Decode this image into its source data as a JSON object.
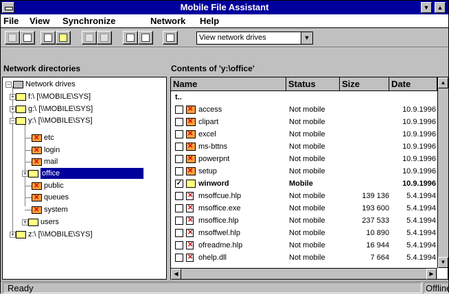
{
  "window": {
    "title": "Mobile File Assistant"
  },
  "menu": [
    {
      "label": "File"
    },
    {
      "label": "View"
    },
    {
      "label": "Synchronize"
    },
    {
      "label": "Network"
    },
    {
      "label": "Help"
    }
  ],
  "toolbar": {
    "view_select": "View network drives"
  },
  "tree_panel": {
    "header": "Network directories"
  },
  "contents_panel": {
    "header": "Contents of 'y:\\office'"
  },
  "tree": [
    {
      "label": "Network drives"
    },
    {
      "label": "f:\\  [\\\\MOBILE\\SYS]"
    },
    {
      "label": "g:\\  [\\\\MOBILE\\SYS]"
    },
    {
      "label": "y:\\  [\\\\MOBILE\\SYS]"
    },
    {
      "label": "etc"
    },
    {
      "label": "login"
    },
    {
      "label": "mail"
    },
    {
      "label": "office"
    },
    {
      "label": "public"
    },
    {
      "label": "queues"
    },
    {
      "label": "system"
    },
    {
      "label": "users"
    },
    {
      "label": "z:\\  [\\\\MOBILE\\SYS]"
    }
  ],
  "columns": {
    "name": "Name",
    "status": "Status",
    "size": "Size",
    "date": "Date"
  },
  "parent_link": "t..",
  "rows": [
    {
      "name": "access",
      "status": "Not mobile",
      "size": "",
      "date": "10.9.1996"
    },
    {
      "name": "clipart",
      "status": "Not mobile",
      "size": "",
      "date": "10.9.1996"
    },
    {
      "name": "excel",
      "status": "Not mobile",
      "size": "",
      "date": "10.9.1996"
    },
    {
      "name": "ms-bttns",
      "status": "Not mobile",
      "size": "",
      "date": "10.9.1996"
    },
    {
      "name": "powerpnt",
      "status": "Not mobile",
      "size": "",
      "date": "10.9.1996"
    },
    {
      "name": "setup",
      "status": "Not mobile",
      "size": "",
      "date": "10.9.1996"
    },
    {
      "name": "winword",
      "status": "Mobile",
      "size": "",
      "date": "10.9.1996",
      "checked": "✓"
    },
    {
      "name": "msoffcue.hlp",
      "status": "Not mobile",
      "size": "139 136",
      "date": "5.4.1994"
    },
    {
      "name": "msoffice.exe",
      "status": "Not mobile",
      "size": "193 600",
      "date": "5.4.1994"
    },
    {
      "name": "msoffice.hlp",
      "status": "Not mobile",
      "size": "237 533",
      "date": "5.4.1994"
    },
    {
      "name": "msoffwel.hlp",
      "status": "Not mobile",
      "size": "10 890",
      "date": "5.4.1994"
    },
    {
      "name": "ofreadme.hlp",
      "status": "Not mobile",
      "size": "16 944",
      "date": "5.4.1994"
    },
    {
      "name": "ohelp.dll",
      "status": "Not mobile",
      "size": "7 664",
      "date": "5.4.1994"
    }
  ],
  "status": {
    "message": "Ready",
    "mode": "Offline"
  }
}
